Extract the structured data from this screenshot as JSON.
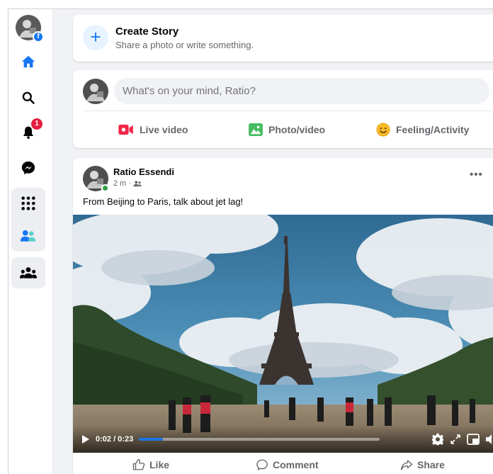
{
  "nav": {
    "notification_count": "1",
    "icons": [
      "home-icon",
      "search-icon",
      "bell-icon",
      "messenger-icon",
      "menu-grid-icon",
      "friends-icon",
      "groups-icon"
    ]
  },
  "story": {
    "title": "Create Story",
    "subtitle": "Share a photo or write something."
  },
  "composer": {
    "placeholder": "What's on your mind, Ratio?",
    "actions": [
      {
        "label": "Live video",
        "color": "#f02849"
      },
      {
        "label": "Photo/video",
        "color": "#45bd62"
      },
      {
        "label": "Feeling/Activity",
        "color": "#f7b928"
      }
    ]
  },
  "post": {
    "author": "Ratio Essendi",
    "time": "2 m",
    "separator": "·",
    "text": "From Beijing to Paris, talk about jet lag!",
    "video": {
      "time": "0:02 / 0:23",
      "progress": 0.1
    },
    "actions": {
      "like": "Like",
      "comment": "Comment",
      "share": "Share"
    }
  },
  "colors": {
    "accent": "#1877f2",
    "background": "#f0f2f5",
    "badge": "#e41e3f"
  }
}
